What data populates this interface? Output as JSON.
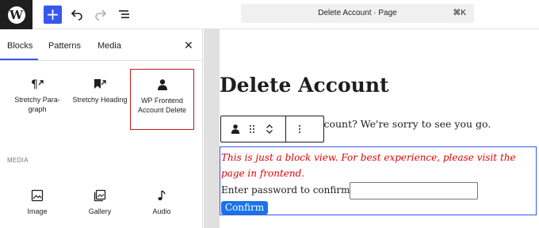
{
  "topbar": {
    "logo_icon": "wordpress-logo",
    "add_icon": "plus-icon",
    "add_label": "+",
    "undo_icon": "undo-icon",
    "redo_icon": "redo-icon",
    "listview_icon": "list-view-icon",
    "command_title": "Delete Account · Page",
    "command_shortcut": "⌘K"
  },
  "sidebar": {
    "tabs": [
      {
        "label": "Blocks",
        "active": true
      },
      {
        "label": "Patterns"
      },
      {
        "label": "Media"
      }
    ],
    "close_label": "✕",
    "blocks": [
      {
        "label": "Stretchy Para-graph",
        "icon": "paragraph-arrow-icon"
      },
      {
        "label": "Stretchy Heading",
        "icon": "bookmark-arrow-icon"
      },
      {
        "label": "WP Frontend Account Delete",
        "icon": "person-icon",
        "highlighted": true
      }
    ],
    "section_label": "MEDIA",
    "media_blocks": [
      {
        "label": "Image",
        "icon": "image-icon"
      },
      {
        "label": "Gallery",
        "icon": "gallery-icon"
      },
      {
        "label": "Audio",
        "icon": "music-note-icon"
      }
    ]
  },
  "canvas": {
    "title": "Delete Account",
    "paragraph": "account? We're sorry to see you go.",
    "notice": "This is just a block view. For best experience, please visit the page in frontend.",
    "password_label": "Enter password to confirm:",
    "password_value": "",
    "confirm_label": "Confirm"
  },
  "colors": {
    "accent": "#3858e9",
    "notice": "#e00000",
    "confirm_button": "#1a73e8",
    "highlight_border": "#cc1818"
  }
}
